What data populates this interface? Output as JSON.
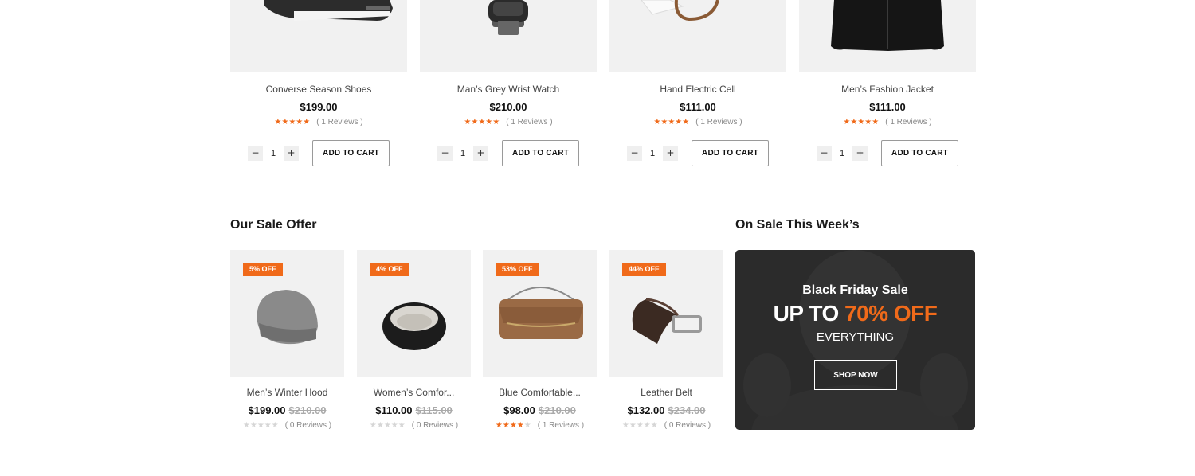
{
  "top_products": [
    {
      "name": "Converse Season Shoes",
      "price": "$199.00",
      "rating": 5,
      "reviews": "( 1 Reviews )",
      "qty": "1",
      "add_to_cart": "ADD TO CART",
      "image": "black-sneaker-image"
    },
    {
      "name": "Man’s Grey Wrist Watch",
      "price": "$210.00",
      "rating": 5,
      "reviews": "( 1 Reviews )",
      "qty": "1",
      "add_to_cart": "ADD TO CART",
      "image": "wrist-watch-image"
    },
    {
      "name": "Hand Electric Cell",
      "price": "$111.00",
      "rating": 5,
      "reviews": "( 1 Reviews )",
      "qty": "1",
      "add_to_cart": "ADD TO CART",
      "image": "leather-strap-image"
    },
    {
      "name": "Men’s Fashion Jacket",
      "price": "$111.00",
      "rating": 5,
      "reviews": "( 1 Reviews )",
      "qty": "1",
      "add_to_cart": "ADD TO CART",
      "image": "black-jacket-image"
    }
  ],
  "qty_minus": "−",
  "qty_plus": "+",
  "sale_section": {
    "title": "Our Sale Offer",
    "items": [
      {
        "badge": "5% OFF",
        "name": "Men’s Winter Hood",
        "price": "$199.00",
        "old_price": "$210.00",
        "rating": 0,
        "reviews": "( 0 Reviews )",
        "image": "beanie-image"
      },
      {
        "badge": "4% OFF",
        "name": "Women’s Comfor...",
        "price": "$110.00",
        "old_price": "$115.00",
        "rating": 0,
        "reviews": "( 0 Reviews )",
        "image": "headband-image"
      },
      {
        "badge": "53% OFF",
        "name": "Blue Comfortable...",
        "price": "$98.00",
        "old_price": "$210.00",
        "rating": 4,
        "reviews": "( 1 Reviews )",
        "image": "handbag-image"
      },
      {
        "badge": "44% OFF",
        "name": "Leather Belt",
        "price": "$132.00",
        "old_price": "$234.00",
        "rating": 0,
        "reviews": "( 0 Reviews )",
        "image": "belt-image"
      }
    ]
  },
  "weekly_section": {
    "title": "On Sale This Week’s"
  },
  "banner": {
    "subtitle": "Black Friday Sale",
    "headline_prefix": "UP TO ",
    "headline_accent": "70% OFF",
    "everything": "EVERYTHING",
    "button": "SHOP NOW"
  },
  "colors": {
    "accent": "#f06a1a",
    "star_off": "#d6d6d6",
    "card_bg": "#f1f1f1",
    "banner_bg": "#2b2b2b"
  }
}
